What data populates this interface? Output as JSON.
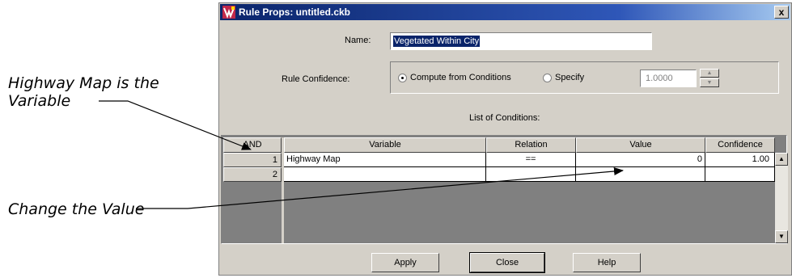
{
  "annotations": {
    "highway_line1": "Highway Map is the",
    "highway_line2": "Variable",
    "change_value": "Change the Value"
  },
  "window": {
    "title": "Rule Props: untitled.ckb",
    "close_glyph": "x"
  },
  "form": {
    "name_label": "Name:",
    "name_value": "Vegetated Within City",
    "confidence_label": "Rule Confidence:",
    "radio_compute": "Compute from Conditions",
    "radio_specify": "Specify",
    "selected_radio": "compute",
    "specify_value": "1.0000",
    "conditions_label": "List of Conditions:"
  },
  "table": {
    "columns": {
      "and": "AND",
      "variable": "Variable",
      "relation": "Relation",
      "value": "Value",
      "confidence": "Confidence"
    },
    "rows": [
      {
        "num": "1",
        "variable": "Highway Map",
        "relation": "==",
        "value": "0",
        "confidence": "1.00"
      },
      {
        "num": "2",
        "variable": "",
        "relation": "",
        "value": "",
        "confidence": ""
      }
    ]
  },
  "buttons": {
    "apply": "Apply",
    "close": "Close",
    "help": "Help"
  },
  "colors": {
    "titlebar": "#0a246a",
    "dialog_bg": "#d4d0c8",
    "selection": "#0a246a"
  }
}
